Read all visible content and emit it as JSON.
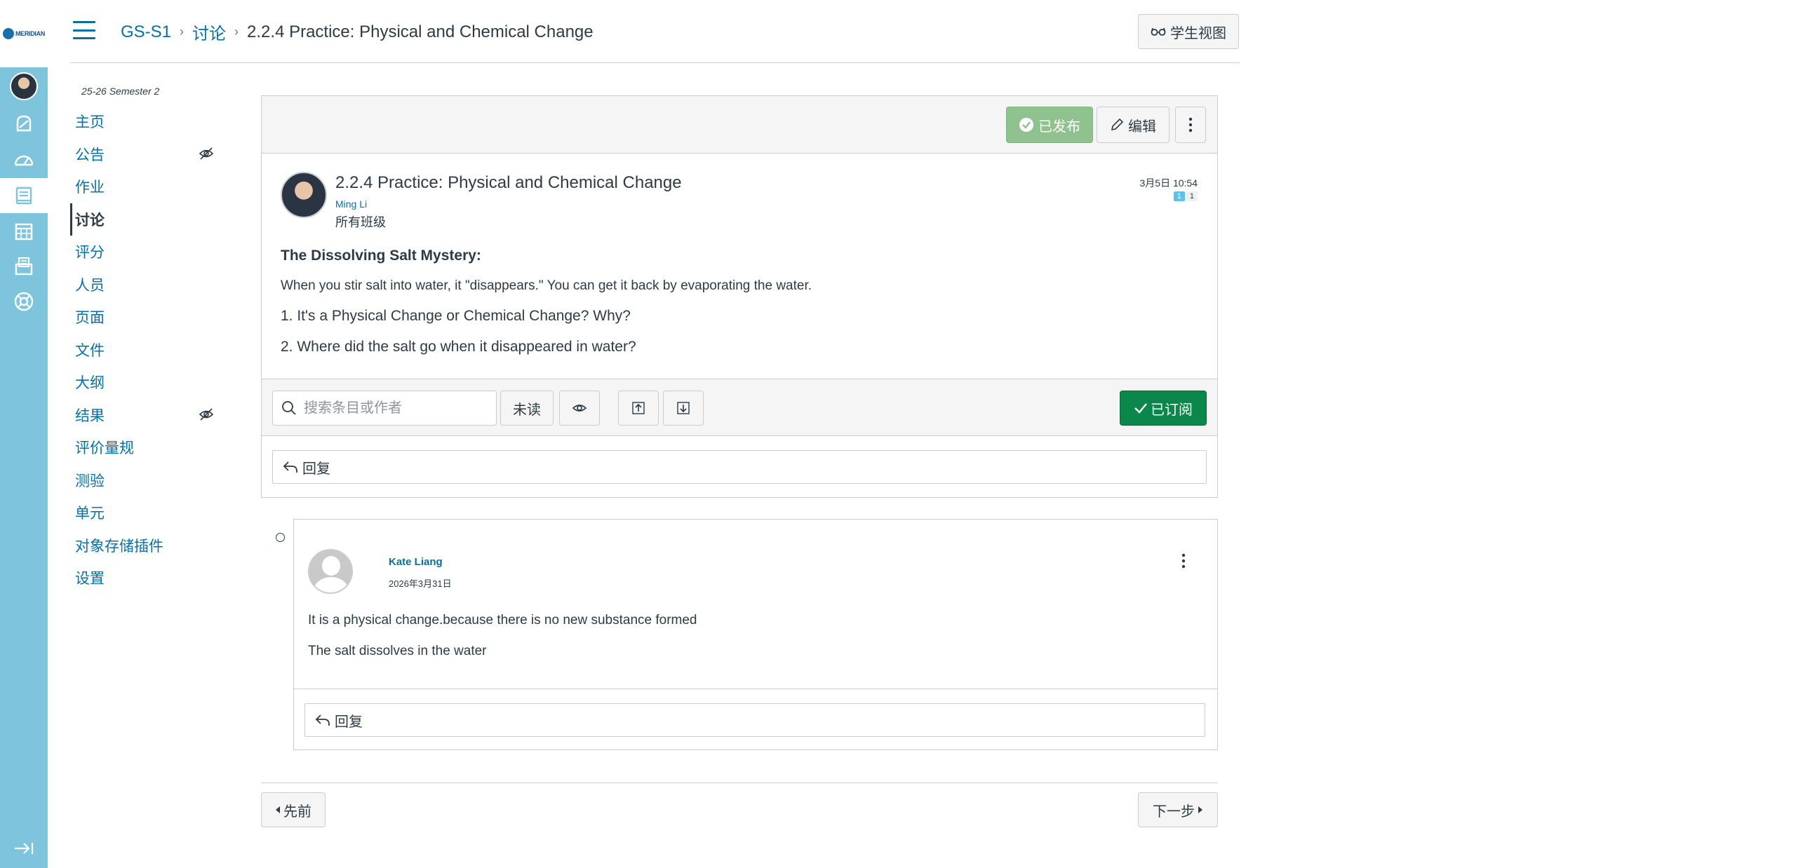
{
  "brand": {
    "logo_text": "MERIDIAN"
  },
  "breadcrumb": {
    "course": "GS-S1",
    "section": "讨论",
    "current": "2.2.4 Practice: Physical and Chemical Change",
    "separator": "›"
  },
  "header": {
    "student_view_label": "学生视图"
  },
  "course_nav": {
    "term": "25-26 Semester 2",
    "items": [
      {
        "label": "主页"
      },
      {
        "label": "公告",
        "hidden": true
      },
      {
        "label": "作业"
      },
      {
        "label": "讨论",
        "active": true
      },
      {
        "label": "评分"
      },
      {
        "label": "人员"
      },
      {
        "label": "页面"
      },
      {
        "label": "文件"
      },
      {
        "label": "大纲"
      },
      {
        "label": "结果",
        "hidden": true
      },
      {
        "label": "评价量规"
      },
      {
        "label": "测验"
      },
      {
        "label": "单元"
      },
      {
        "label": "对象存储插件"
      },
      {
        "label": "设置"
      }
    ]
  },
  "topic": {
    "published_label": "已发布",
    "edit_label": "编辑",
    "title": "2.2.4 Practice: Physical and Chemical Change",
    "author": "Ming Li",
    "section": "所有班级",
    "date": "3月5日 10:54",
    "unread_count": "1",
    "total_count": "1",
    "body_heading": "The Dissolving Salt Mystery:",
    "body_text": "When you stir salt into water, it \"disappears.\" You can get it back by evaporating the water.",
    "question_1": "1. It's a Physical Change or Chemical Change?  Why?",
    "question_2": "2. Where did the salt go when it disappeared in water?"
  },
  "filter": {
    "search_placeholder": "搜索条目或作者",
    "unread_label": "未读",
    "subscribed_label": "已订阅"
  },
  "reply_label": "回复",
  "entry": {
    "author": "Kate Liang",
    "date": "2026年3月31日",
    "line_1": "It is a physical change.because there is no new substance formed",
    "line_2": "The salt dissolves in the water",
    "reply_label": "回复"
  },
  "pager": {
    "prev_label": "先前",
    "next_label": "下一步"
  },
  "colors": {
    "sidebar": "#7ec4dd",
    "link": "#0770a3",
    "published": "#8fc28f",
    "subscribed": "#0b874b"
  }
}
